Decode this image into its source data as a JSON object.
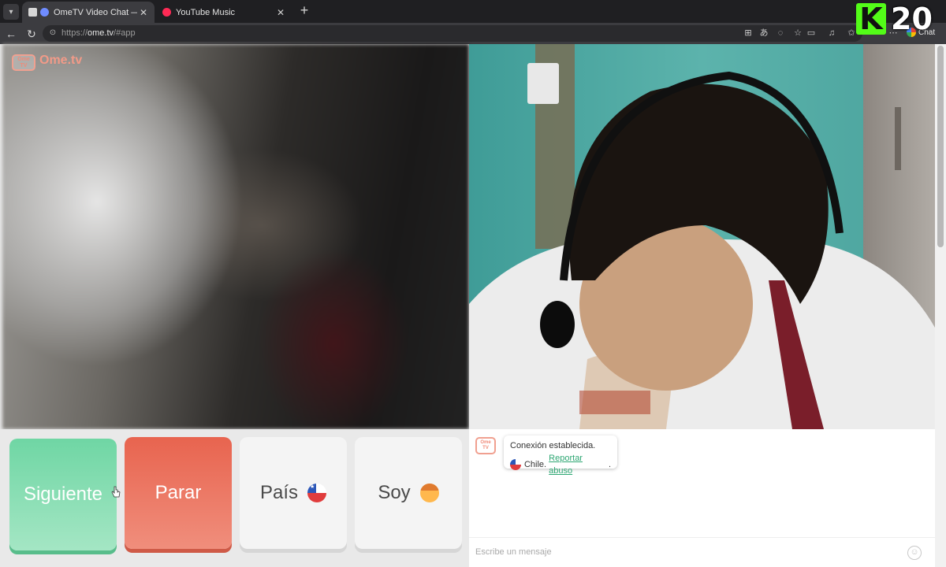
{
  "browser": {
    "tabs": [
      {
        "title": "OmeTV Video Chat — Omegl",
        "active": true,
        "close": "✕"
      },
      {
        "title": "YouTube Music",
        "active": false,
        "close": "✕"
      }
    ],
    "url_prefix": "https://",
    "url_host": "ome.tv",
    "url_path": "/#app",
    "chat_label": "Chat"
  },
  "overlay": {
    "k_letter": "K",
    "number": "20"
  },
  "site": {
    "logo_icon_text": "Ome TV",
    "brand": "Ome.tv"
  },
  "controls": {
    "next_label": "Siguiente",
    "stop_label": "Parar",
    "country_label": "País",
    "gender_label": "Soy"
  },
  "chat": {
    "avatar_text": "Ome TV",
    "status": "Conexión establecida.",
    "country": "Chile.",
    "report_link": "Reportar abuso",
    "report_suffix": ".",
    "input_placeholder": "Escribe un mensaje"
  },
  "colors": {
    "next": "#6fd6a4",
    "stop": "#e8644f",
    "link": "#2ea773",
    "kick_green": "#53fc18"
  }
}
